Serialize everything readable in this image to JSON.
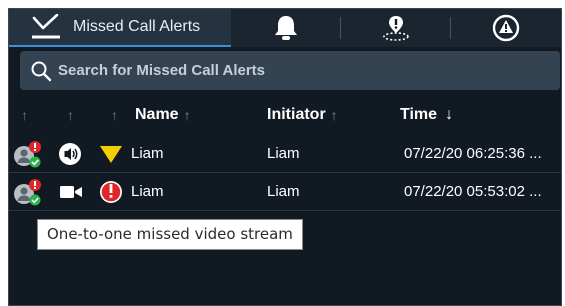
{
  "tabs": {
    "active_label": "Missed Call Alerts"
  },
  "search": {
    "placeholder": "Search for Missed Call Alerts"
  },
  "columns": {
    "name": "Name",
    "initiator": "Initiator",
    "time": "Time",
    "time_sort": "↓",
    "unsorted": "↑"
  },
  "rows": [
    {
      "name": "Liam",
      "initiator": "Liam",
      "time": "07/22/20 06:25:36 ...",
      "type_icon": "audio-call-icon",
      "priority_icon": "yellow-triangle-icon",
      "colors": {
        "priority": "#f2d000"
      }
    },
    {
      "name": "Liam",
      "initiator": "Liam",
      "time": "07/22/20 05:53:02 ...",
      "type_icon": "video-camera-icon",
      "priority_icon": "red-alarm-icon",
      "colors": {
        "priority": "#e0262a"
      }
    }
  ],
  "tooltip": {
    "text": "One-to-one missed video stream"
  },
  "colors": {
    "panel_bg": "#111922",
    "accent": "#3a8fd8",
    "search_bg": "#344352",
    "badge_red": "#e0262a",
    "badge_green": "#2db34a"
  }
}
